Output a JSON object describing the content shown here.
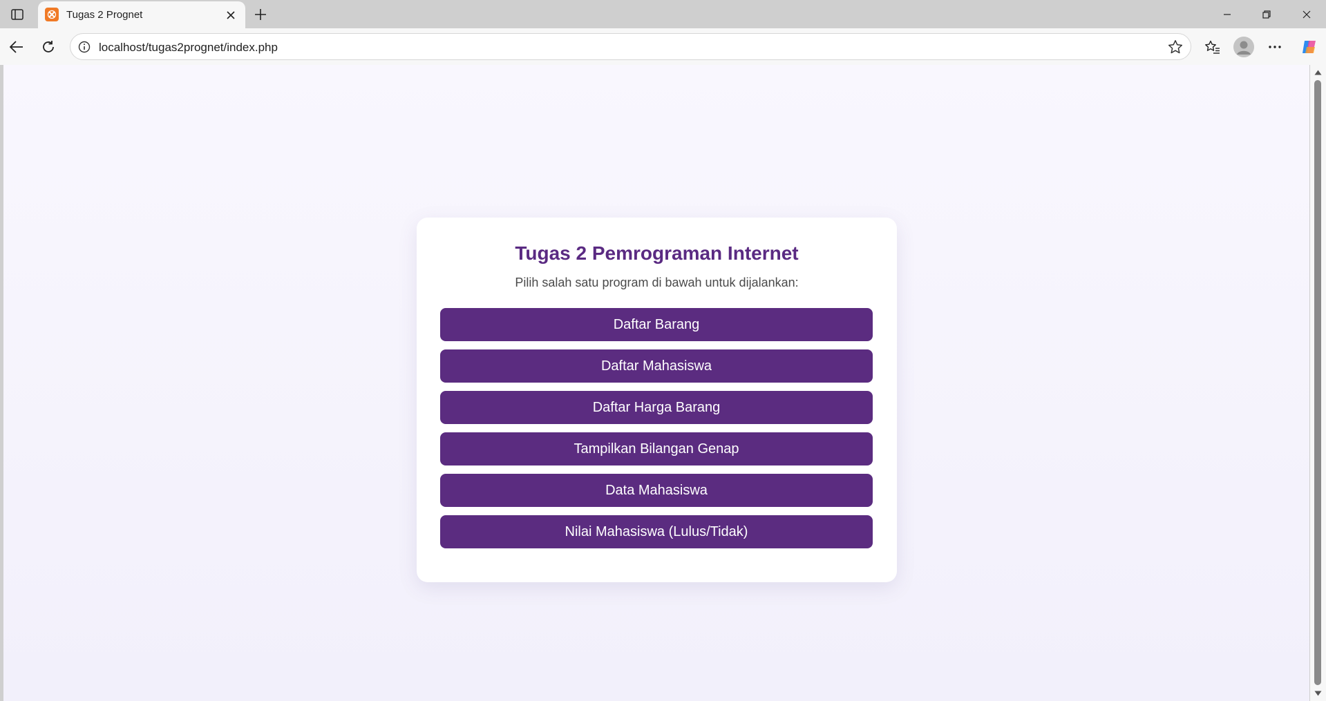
{
  "browser": {
    "tab_title": "Tugas 2 Prognet",
    "url": "localhost/tugas2prognet/index.php"
  },
  "page": {
    "title": "Tugas 2 Pemrograman Internet",
    "subtitle": "Pilih salah satu program di bawah untuk dijalankan:",
    "menu": [
      {
        "label": "Daftar Barang"
      },
      {
        "label": "Daftar Mahasiswa"
      },
      {
        "label": "Daftar Harga Barang"
      },
      {
        "label": "Tampilkan Bilangan Genap"
      },
      {
        "label": "Data Mahasiswa"
      },
      {
        "label": "Nilai Mahasiswa (Lulus/Tidak)"
      }
    ]
  },
  "colors": {
    "accent": "#5b2c80",
    "title": "#5a2a82",
    "favicon": "#f07a26"
  },
  "icons": [
    "sidebar-toggle-icon",
    "xampp-icon",
    "close-icon",
    "plus-icon",
    "minimize-icon",
    "restore-icon",
    "back-icon",
    "refresh-icon",
    "info-icon",
    "star-icon",
    "favorites-icon",
    "avatar-icon",
    "more-icon",
    "copilot-icon"
  ]
}
